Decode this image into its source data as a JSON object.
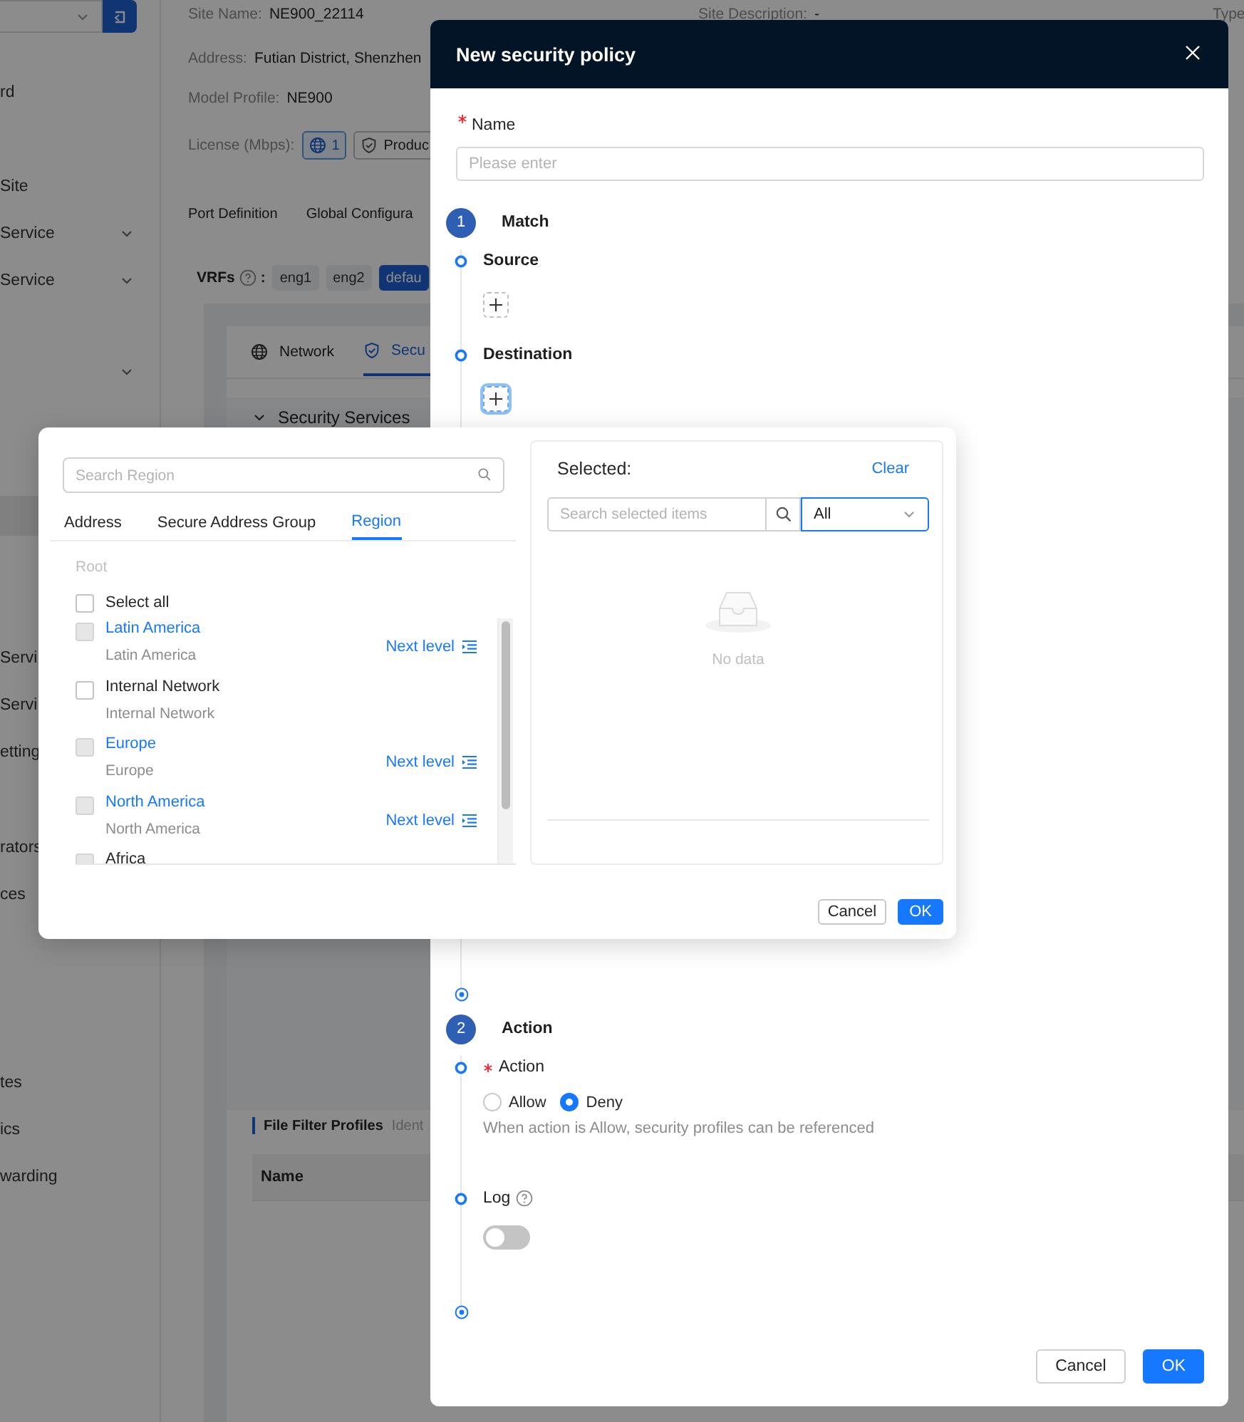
{
  "background": {
    "sidebar": {
      "items": [
        {
          "label": "rd",
          "expandable": false,
          "selected": false
        },
        {
          "label": "Site",
          "expandable": false,
          "selected": false
        },
        {
          "label": "Service",
          "expandable": true,
          "selected": false
        },
        {
          "label": "Service",
          "expandable": true,
          "selected": false
        },
        {
          "expandable": true,
          "selected": false
        },
        {
          "expandable": false,
          "selected": true
        },
        {
          "label": "Servi",
          "selected": false
        },
        {
          "label": "Servi",
          "selected": false
        },
        {
          "label": "etting",
          "selected": false
        },
        {
          "label": "rators",
          "selected": false
        },
        {
          "label": "ces",
          "selected": false
        },
        {
          "label": "tes",
          "expandable": false,
          "selected": false
        },
        {
          "label": "ics",
          "expandable": false,
          "selected": false
        },
        {
          "label": "warding",
          "expandable": false,
          "selected": false
        }
      ]
    },
    "site": {
      "top_row": [
        {
          "label": "Site Name:",
          "value": "NE900_22114"
        },
        {
          "label": "Site Description:",
          "value": "-"
        },
        {
          "label": "Type"
        }
      ],
      "fields": [
        {
          "label": "Address:",
          "value": "Futian District, Shenzhen"
        },
        {
          "label": "Model Profile:",
          "value": "NE900"
        }
      ],
      "license": {
        "label": "License (Mbps):",
        "tags": [
          {
            "kind": "bandwidth",
            "text": "1"
          },
          {
            "kind": "product",
            "text": "Produc"
          }
        ]
      }
    },
    "page_tabs": [
      {
        "label": "Port Definition",
        "selected": false
      },
      {
        "label": "Global Configura",
        "selected": false
      }
    ],
    "vrfs": {
      "label": "VRFs",
      "suffix": ":",
      "items": [
        {
          "label": "eng1",
          "selected": false
        },
        {
          "label": "eng2",
          "selected": false
        },
        {
          "label": "defau",
          "selected": true
        }
      ]
    },
    "card_tabs": [
      {
        "kind": "network",
        "label": "Network",
        "selected": false
      },
      {
        "kind": "security",
        "label": "Secu",
        "selected": true
      }
    ],
    "section": {
      "title": "Security Services",
      "expanded": true
    },
    "file_filter": {
      "title": "File Filter Profiles",
      "subtitle": "Ident",
      "columns": [
        "Name"
      ]
    }
  },
  "drawer": {
    "title": "New security policy",
    "name_field": {
      "label": "Name",
      "required": true,
      "placeholder": "Please enter"
    },
    "steps": [
      {
        "number": "1",
        "title": "Match",
        "fields": [
          {
            "kind": "add",
            "label": "Source",
            "focused": false
          },
          {
            "kind": "add",
            "label": "Destination",
            "focused": true
          }
        ]
      },
      {
        "number": "2",
        "title": "Action",
        "fields": [
          {
            "kind": "radio",
            "label": "Action",
            "required": true,
            "options": [
              {
                "label": "Allow",
                "selected": false
              },
              {
                "label": "Deny",
                "selected": true
              }
            ],
            "help": "When action is Allow, security profiles can be referenced"
          },
          {
            "kind": "switch",
            "label": "Log",
            "has_help": true,
            "on": false
          }
        ]
      }
    ],
    "buttons": [
      {
        "label": "Cancel",
        "primary": false
      },
      {
        "label": "OK",
        "primary": true
      }
    ]
  },
  "picker": {
    "search_placeholder": "Search Region",
    "tabs": [
      {
        "label": "Address",
        "selected": false
      },
      {
        "label": "Secure Address Group",
        "selected": false
      },
      {
        "label": "Region",
        "selected": true
      }
    ],
    "root": "Root",
    "select_all": {
      "label": "Select all",
      "checked": false
    },
    "items": [
      {
        "name": "Latin America",
        "description": "Latin America",
        "checked": false,
        "disabled": true,
        "next_level": "Next level"
      },
      {
        "name": "Internal Network",
        "description": "Internal Network",
        "checked": false,
        "disabled": false
      },
      {
        "name": "Europe",
        "description": "Europe",
        "checked": false,
        "disabled": true,
        "next_level": "Next level"
      },
      {
        "name": "North America",
        "description": "North America",
        "checked": false,
        "disabled": true,
        "next_level": "Next level"
      },
      {
        "name": "Africa",
        "checked": false,
        "disabled": true
      }
    ],
    "selected_panel": {
      "title": "Selected:",
      "clear": "Clear",
      "search_placeholder": "Search selected items",
      "filter": "All",
      "empty": "No data"
    },
    "buttons": [
      {
        "label": "Cancel",
        "primary": false
      },
      {
        "label": "OK",
        "primary": true
      }
    ]
  }
}
